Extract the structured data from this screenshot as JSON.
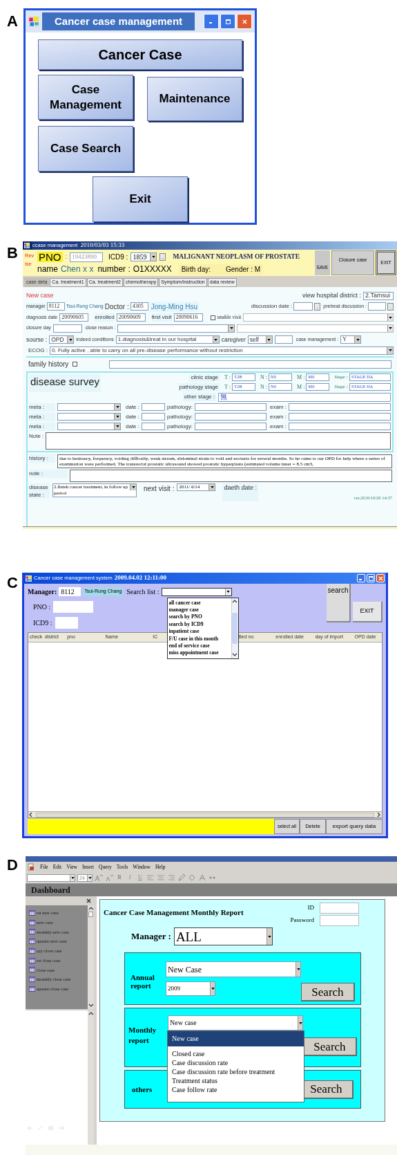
{
  "panel_a": {
    "label": "A",
    "title": "Cancer case management",
    "buttons": [
      "Cancer Case",
      "Case Management",
      "Maintenance",
      "Case Search",
      "Exit"
    ]
  },
  "panel_b": {
    "label": "B",
    "title": "ccase management",
    "timestamp": "2010/03/03 15:33",
    "header": {
      "revise": "Revise",
      "pno_label": "PNO",
      "pno_colon": ":",
      "pno": "19423890",
      "icd9_label": "ICD9 :",
      "icd9": "1859",
      "icd9_button": ".",
      "diagnosis": "MALIGNANT NEOPLASM OF PROSTATE",
      "name_label": "name",
      "name": "Chen x x",
      "number_label": "number :",
      "number": "O1XXXXX",
      "birthday_label": "Birth day:",
      "gender": "Gender : M"
    },
    "buttons": [
      "SAVE",
      "Closure case",
      "EXIT"
    ],
    "tabs": [
      {
        "label": "case deta",
        "selected": true
      },
      {
        "label": "Ca. treatment1",
        "selected": false
      },
      {
        "label": "Ca. treatment2",
        "selected": false
      },
      {
        "label": "chemotherapy",
        "selected": false
      },
      {
        "label": "Symptom/instruction",
        "selected": false
      },
      {
        "label": "data review",
        "selected": false
      }
    ],
    "case": {
      "status": "New case",
      "district_label": "view hospital district :",
      "district": "2.Tamsui",
      "manager_label": "manager",
      "manager_id": "8112",
      "manager_name": "Tsui-Rung Chang",
      "doctor_label": "Doctor :",
      "doctor_id": "4305",
      "doctor_name": "Jong-Ming Hsu",
      "discussion": {
        "label": "discussion date :",
        "button": "."
      },
      "pretreat": {
        "label": "pretreat discussion :",
        "button": "."
      },
      "diagnosis_label": "diagnosis date",
      "diagnosis_date": "20090605",
      "enrolled_label": "enrolled",
      "enrolled": "20090609",
      "first_visit_label": "first visit",
      "first_visit": "20090616",
      "unable_visit": {
        "label": "unable visit",
        "checked": false
      },
      "closure_label": "closure day",
      "close_reason_label": "close reason :",
      "source_label": "sourse :",
      "source": "OPD",
      "conditions_label": "indeed conditions",
      "conditions": "1.diagnosis&treat in our hospital",
      "caregiver_label": "caregiver",
      "caregiver": "self",
      "case_management_label": "case management :",
      "case_management": "Y",
      "ecog_label": "ECOG :",
      "ecog": "0. Fully active , able to carry on all pre-disease performance without restriction",
      "family_history": {
        "label": "family history",
        "checked": false
      }
    },
    "survey": {
      "title": "disease survey",
      "stages": [
        {
          "label": "clinic stage",
          "fields": [
            {
              "label": "T :",
              "value": "T2B"
            },
            {
              "label": "N :",
              "value": "N0"
            },
            {
              "label": "M :",
              "value": "M0"
            },
            {
              "label": "Stage :",
              "value": "STAGE IIA"
            }
          ]
        },
        {
          "label": "pathology stage",
          "fields": [
            {
              "label": "T :",
              "value": "T2B"
            },
            {
              "label": "N :",
              "value": "N0"
            },
            {
              "label": "M :",
              "value": "M0"
            },
            {
              "label": "Stage :",
              "value": "STAGE IIA"
            }
          ]
        }
      ],
      "other_stage_label": "other stage :",
      "other_stage": "無",
      "meta_rows": [
        {
          "meta_label": "meta :",
          "date_label": "date :",
          "pathology_label": "pathology:",
          "exam_label": "exam :"
        },
        {
          "meta_label": "meta :",
          "date_label": "date :",
          "pathology_label": "pathology:",
          "exam_label": "exam :"
        },
        {
          "meta_label": "meta :",
          "date_label": "date :",
          "pathology_label": "pathology:",
          "exam_label": "exam :"
        }
      ],
      "note_label": "Note :"
    },
    "history": {
      "history_label": "history :",
      "history": "due to hesitancy, frequency, voiding difficulty, weak stream, abdominal strain to void and nocturia for several months. So he came to our OPD for help where a series of examination were performed. The transrectal prostatic ultrasound showed prostatic hyperplasia (estimated volume inner = 8.5 cm3,",
      "note_label": "note :",
      "disease_state_label": "disease state :",
      "disease_state": "2.finish cancer treatment, in follow up period",
      "next_visit_label": "next visit :",
      "next_visit": "2011/ 6/14",
      "death_label": "daeth date :",
      "version": "ver.2010/10/20 14:37"
    }
  },
  "panel_c": {
    "label": "C",
    "title": "Cancer case management system",
    "timestamp": "2009.04.02 12:11:00",
    "manager_label": "Manager:",
    "manager_id": "8112",
    "manager_name": "Tsui-Rung Chang",
    "search_list_label": "Search list :",
    "search_options": [
      {
        "label": "all cancer case",
        "selected": false
      },
      {
        "label": "manager case",
        "selected": false
      },
      {
        "label": "search by PNO",
        "selected": false
      },
      {
        "label": "search by ICD9",
        "selected": false
      },
      {
        "label": "inpatient case",
        "selected": false
      },
      {
        "label": "F/U case in this month",
        "selected": false
      },
      {
        "label": "end of service case",
        "selected": false
      },
      {
        "label": "miss appointment case",
        "selected": false
      }
    ],
    "search_button": "search",
    "exit_button": "EXIT",
    "pno_label": "PNO :",
    "icd9_label": "ICD9 :",
    "columns": [
      "check",
      "district",
      "pno",
      "Name",
      "IC",
      "Bed no",
      "enrolled date",
      "day of import",
      "OPD date"
    ],
    "footer_buttons": [
      "select all",
      "Delete",
      "export query data"
    ]
  },
  "panel_d": {
    "label": "D",
    "menu": [
      "File",
      "Edit",
      "View",
      "Insert",
      "Query",
      "Tools",
      "Window",
      "Help"
    ],
    "font_size": "24",
    "format_buttons": [
      "B",
      "I",
      "U"
    ],
    "toolbar_title": "Dashboard",
    "sidebar_items": [
      "rst new case",
      "new case",
      "monthly new case",
      "quarter new case",
      "qry close case",
      "rst close case",
      "close case",
      "monthly close case",
      "quarter close case"
    ],
    "report": {
      "title": "Cancer Case Management Monthly Report",
      "id_label": "ID",
      "password_label": "Password",
      "manager_label": "Manager :",
      "manager": "ALL",
      "sections": [
        {
          "kind": "annual",
          "label": "Annual report",
          "selects": [
            "New Case",
            "2009"
          ],
          "button": "Search"
        },
        {
          "kind": "monthly",
          "label": "Monthly report",
          "selects": [
            "New case"
          ],
          "button": "Search",
          "options": [
            {
              "label": "New case",
              "selected": true
            },
            {
              "label": "Closed case",
              "selected": false
            },
            {
              "label": "Case discussion rate",
              "selected": false
            },
            {
              "label": "Case discussion rate before treatment",
              "selected": false
            },
            {
              "label": "Treatment status",
              "selected": false
            },
            {
              "label": "Case follow rate",
              "selected": false
            }
          ]
        },
        {
          "kind": "others",
          "label": "others",
          "button": "Search"
        }
      ]
    }
  }
}
